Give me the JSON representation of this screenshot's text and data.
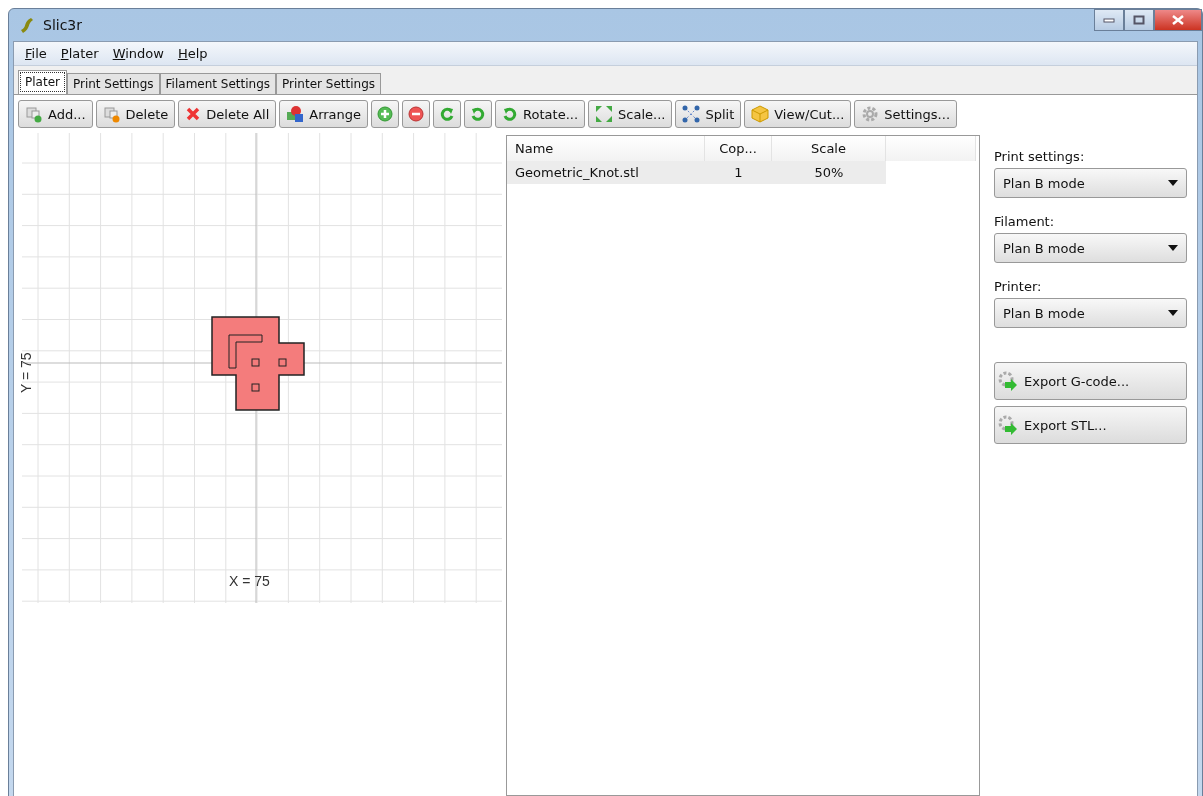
{
  "window": {
    "title": "Slic3r"
  },
  "menu": [
    "File",
    "Plater",
    "Window",
    "Help"
  ],
  "tabs": [
    {
      "label": "Plater",
      "selected": true
    },
    {
      "label": "Print Settings",
      "selected": false
    },
    {
      "label": "Filament Settings",
      "selected": false
    },
    {
      "label": "Printer Settings",
      "selected": false
    }
  ],
  "toolbar": [
    {
      "kind": "text",
      "label": "Add..."
    },
    {
      "kind": "text",
      "label": "Delete"
    },
    {
      "kind": "text",
      "label": "Delete All"
    },
    {
      "kind": "text",
      "label": "Arrange"
    },
    {
      "kind": "icon"
    },
    {
      "kind": "icon"
    },
    {
      "kind": "icon"
    },
    {
      "kind": "icon"
    },
    {
      "kind": "text",
      "label": "Rotate..."
    },
    {
      "kind": "text",
      "label": "Scale..."
    },
    {
      "kind": "text",
      "label": "Split"
    },
    {
      "kind": "text",
      "label": "View/Cut..."
    },
    {
      "kind": "text",
      "label": "Settings..."
    }
  ],
  "plater": {
    "y_label": "Y = 75",
    "x_label": "X = 75"
  },
  "table": {
    "columns": [
      "Name",
      "Cop...",
      "Scale"
    ],
    "rows": [
      {
        "cells": [
          "Geometric_Knot.stl",
          "1",
          "50%"
        ],
        "selected": true
      }
    ]
  },
  "presets": [
    {
      "label": "Print settings:",
      "value": "Plan B mode"
    },
    {
      "label": "Filament:",
      "value": "Plan B mode"
    },
    {
      "label": "Printer:",
      "value": "Plan B mode"
    }
  ],
  "export_buttons": [
    "Export G-code...",
    "Export STL..."
  ]
}
